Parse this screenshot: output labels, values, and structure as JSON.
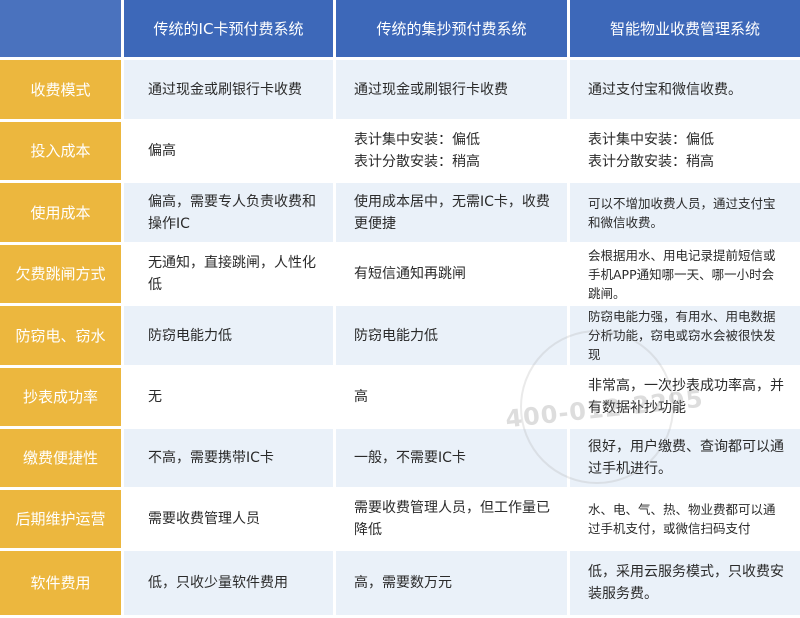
{
  "headers": [
    "",
    "传统的IC卡预付费系统",
    "传统的集抄预付费系统",
    "智能物业收费管理系统"
  ],
  "rows": [
    {
      "label": "收费模式",
      "c1": "通过现金或刷银行卡收费",
      "c2": "通过现金或刷银行卡收费",
      "c3": "通过支付宝和微信收费。"
    },
    {
      "label": "投入成本",
      "c1": "偏高",
      "c2": "表计集中安装：偏低\n表计分散安装：稍高",
      "c3": "表计集中安装：偏低\n表计分散安装：稍高"
    },
    {
      "label": "使用成本",
      "c1": "偏高，需要专人负责收费和操作IC",
      "c2": "使用成本居中，无需IC卡，收费更便捷",
      "c3": "可以不增加收费人员，通过支付宝和微信收费。"
    },
    {
      "label": "欠费跳闸方式",
      "c1": "无通知，直接跳闸，人性化低",
      "c2": "有短信通知再跳闸",
      "c3": "会根据用水、用电记录提前短信或手机APP通知哪一天、哪一小时会跳闸。"
    },
    {
      "label": "防窃电、窃水",
      "c1": "防窃电能力低",
      "c2": "防窃电能力低",
      "c3": "防窃电能力强，有用水、用电数据分析功能，窃电或窃水会被很快发现"
    },
    {
      "label": "抄表成功率",
      "c1": "无",
      "c2": "高",
      "c3": "非常高，一次抄表成功率高，并有数据补抄功能"
    },
    {
      "label": "缴费便捷性",
      "c1": "不高，需要携带IC卡",
      "c2": "一般，不需要IC卡",
      "c3": "很好，用户缴费、查询都可以通过手机进行。"
    },
    {
      "label": "后期维护运营",
      "c1": "需要收费管理人员",
      "c2": "需要收费管理人员，但工作量已降低",
      "c3": "水、电、气、热、物业费都可以通过手机支付，或微信扫码支付"
    },
    {
      "label": "软件费用",
      "c1": "低，只收少量软件费用",
      "c2": "高，需要数万元",
      "c3": "低，采用云服务模式，只收费安装服务费。"
    }
  ],
  "watermark": "400-012-2295",
  "colors": {
    "header": "#3d68b9",
    "rowhead": "#ecb73e",
    "stripe": "#eaf1f9"
  }
}
